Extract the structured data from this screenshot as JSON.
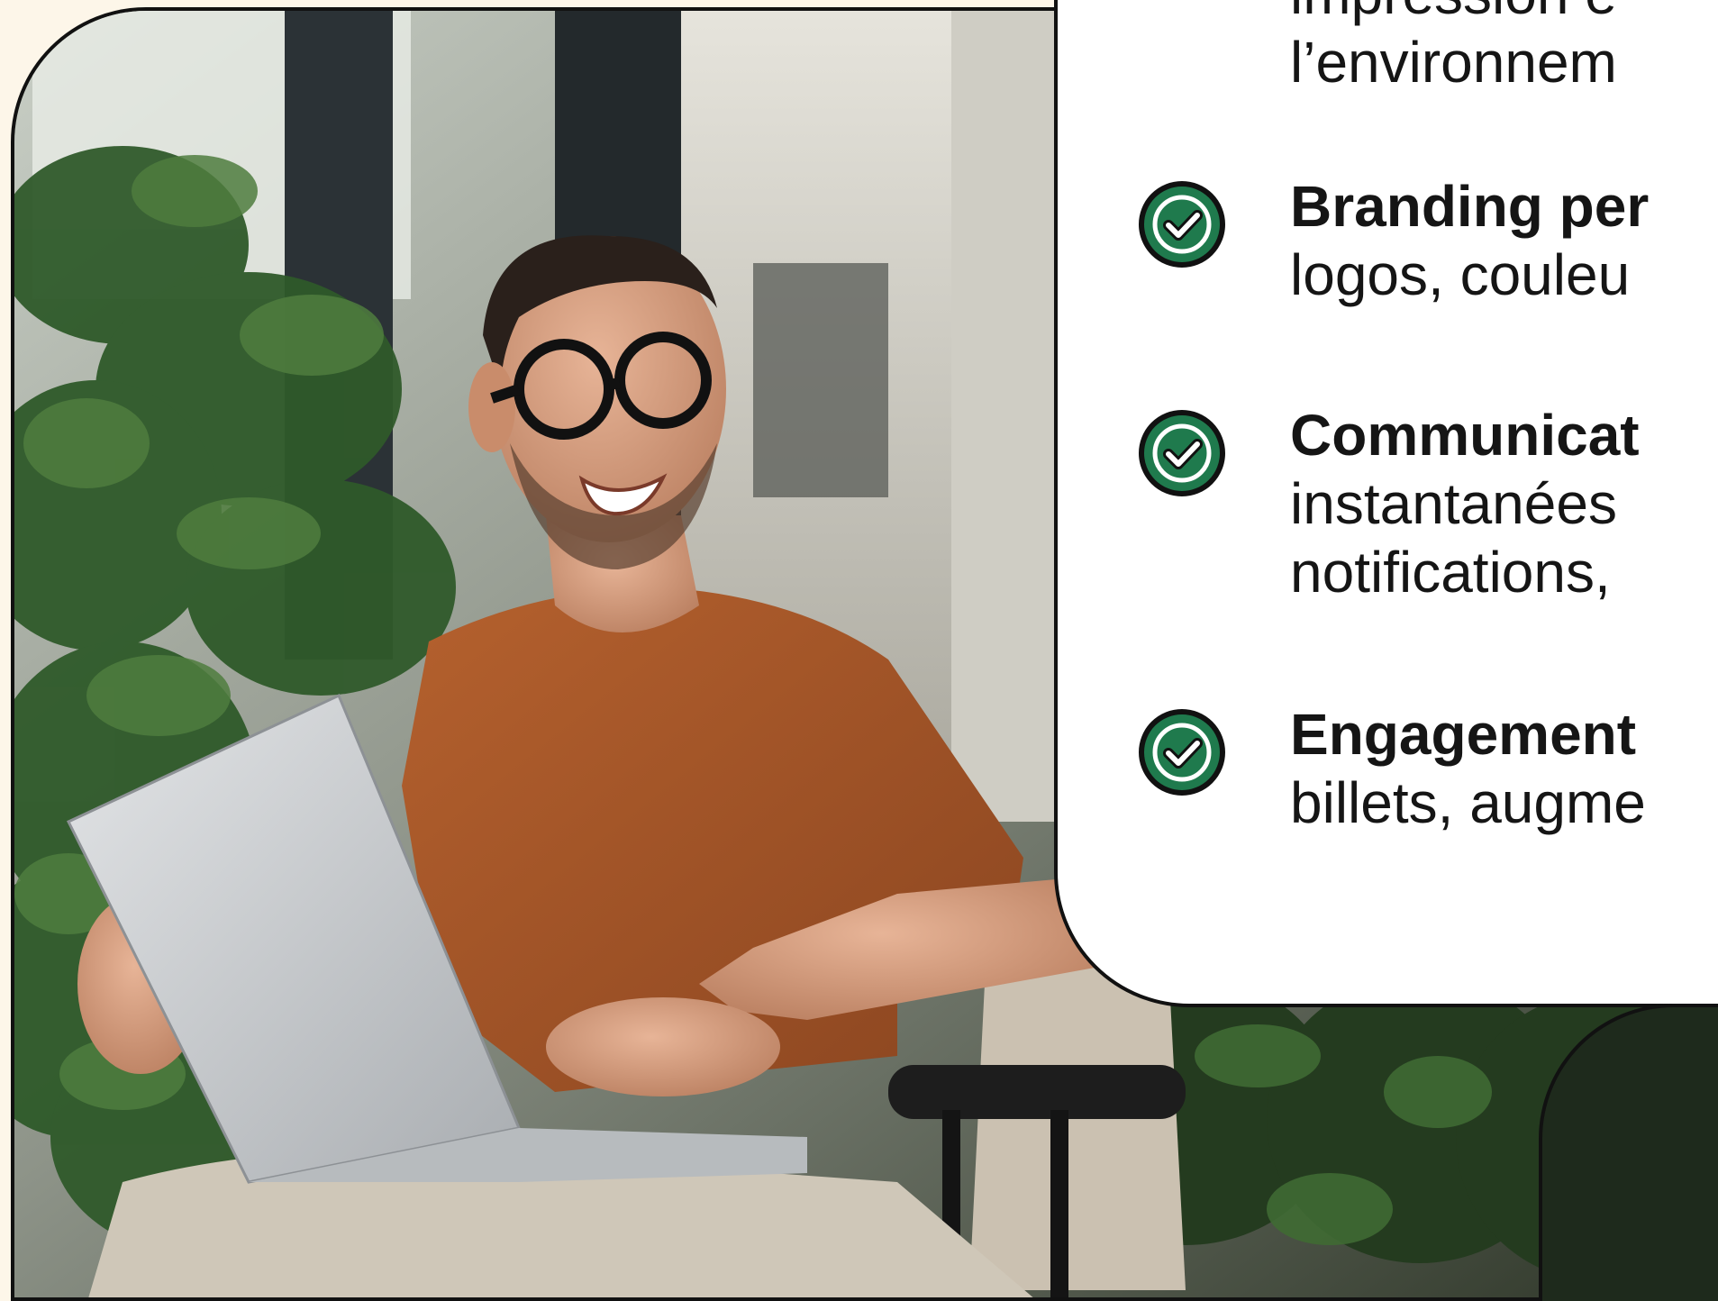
{
  "features": [
    {
      "icon": "check-circle-icon",
      "title": "",
      "description_lines": [
        "impression e",
        "l’environnem"
      ]
    },
    {
      "icon": "check-circle-icon",
      "title": "Branding per",
      "description_lines": [
        "logos, couleu"
      ]
    },
    {
      "icon": "check-circle-icon",
      "title": "Communicat",
      "description_lines": [
        "instantanées",
        "notifications,"
      ]
    },
    {
      "icon": "check-circle-icon",
      "title": "Engagement",
      "description_lines": [
        "billets, augme"
      ]
    }
  ],
  "colors": {
    "page_background": "#fdf6e9",
    "card_background": "#ffffff",
    "check_fill": "#1f7a4d",
    "outline": "#111111",
    "text": "#151515"
  },
  "photo": {
    "icon": "man-with-laptop-photo"
  }
}
